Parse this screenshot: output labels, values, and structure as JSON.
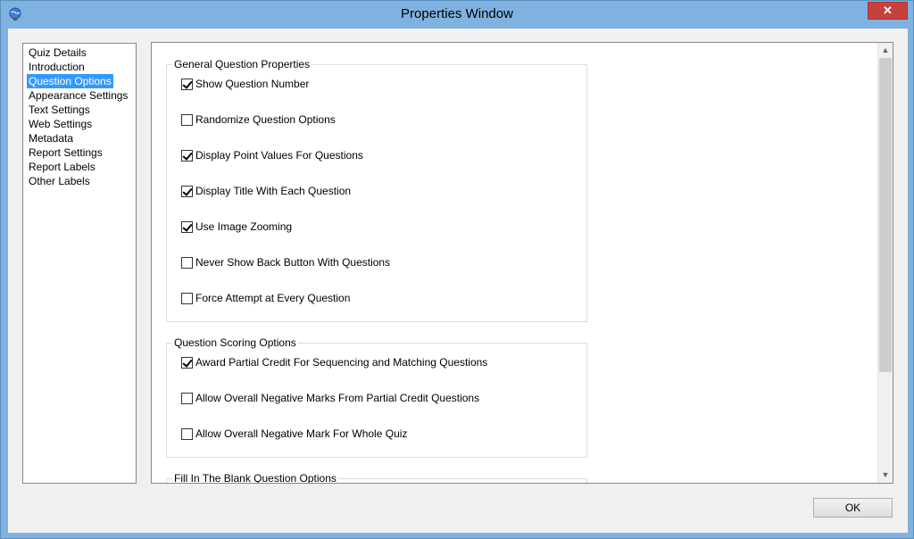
{
  "window": {
    "title": "Properties Window",
    "close_glyph": "✕"
  },
  "nav": {
    "items": [
      {
        "label": "Quiz Details",
        "selected": false
      },
      {
        "label": "Introduction",
        "selected": false
      },
      {
        "label": "Question Options",
        "selected": true
      },
      {
        "label": "Appearance Settings",
        "selected": false
      },
      {
        "label": "Text Settings",
        "selected": false
      },
      {
        "label": "Web Settings",
        "selected": false
      },
      {
        "label": "Metadata",
        "selected": false
      },
      {
        "label": "Report Settings",
        "selected": false
      },
      {
        "label": "Report Labels",
        "selected": false
      },
      {
        "label": "Other Labels",
        "selected": false
      }
    ]
  },
  "groups": {
    "general": {
      "title": "General Question Properties",
      "options": [
        {
          "label": "Show Question Number",
          "checked": true
        },
        {
          "label": "Randomize Question Options",
          "checked": false
        },
        {
          "label": "Display Point Values For Questions",
          "checked": true
        },
        {
          "label": "Display Title With Each Question",
          "checked": true
        },
        {
          "label": "Use Image Zooming",
          "checked": true
        },
        {
          "label": "Never Show Back Button With Questions",
          "checked": false
        },
        {
          "label": "Force Attempt at Every Question",
          "checked": false
        }
      ]
    },
    "scoring": {
      "title": "Question Scoring Options",
      "options": [
        {
          "label": "Award Partial Credit For Sequencing and Matching Questions",
          "checked": true
        },
        {
          "label": "Allow Overall Negative Marks From Partial Credit Questions",
          "checked": false
        },
        {
          "label": "Allow Overall Negative Mark For Whole Quiz",
          "checked": false
        }
      ]
    },
    "fill_blank": {
      "title": "Fill In The Blank Question Options"
    }
  },
  "buttons": {
    "ok": "OK"
  },
  "colors": {
    "selection": "#3399ff",
    "close": "#c7413a",
    "frame": "#7fb2e0"
  }
}
